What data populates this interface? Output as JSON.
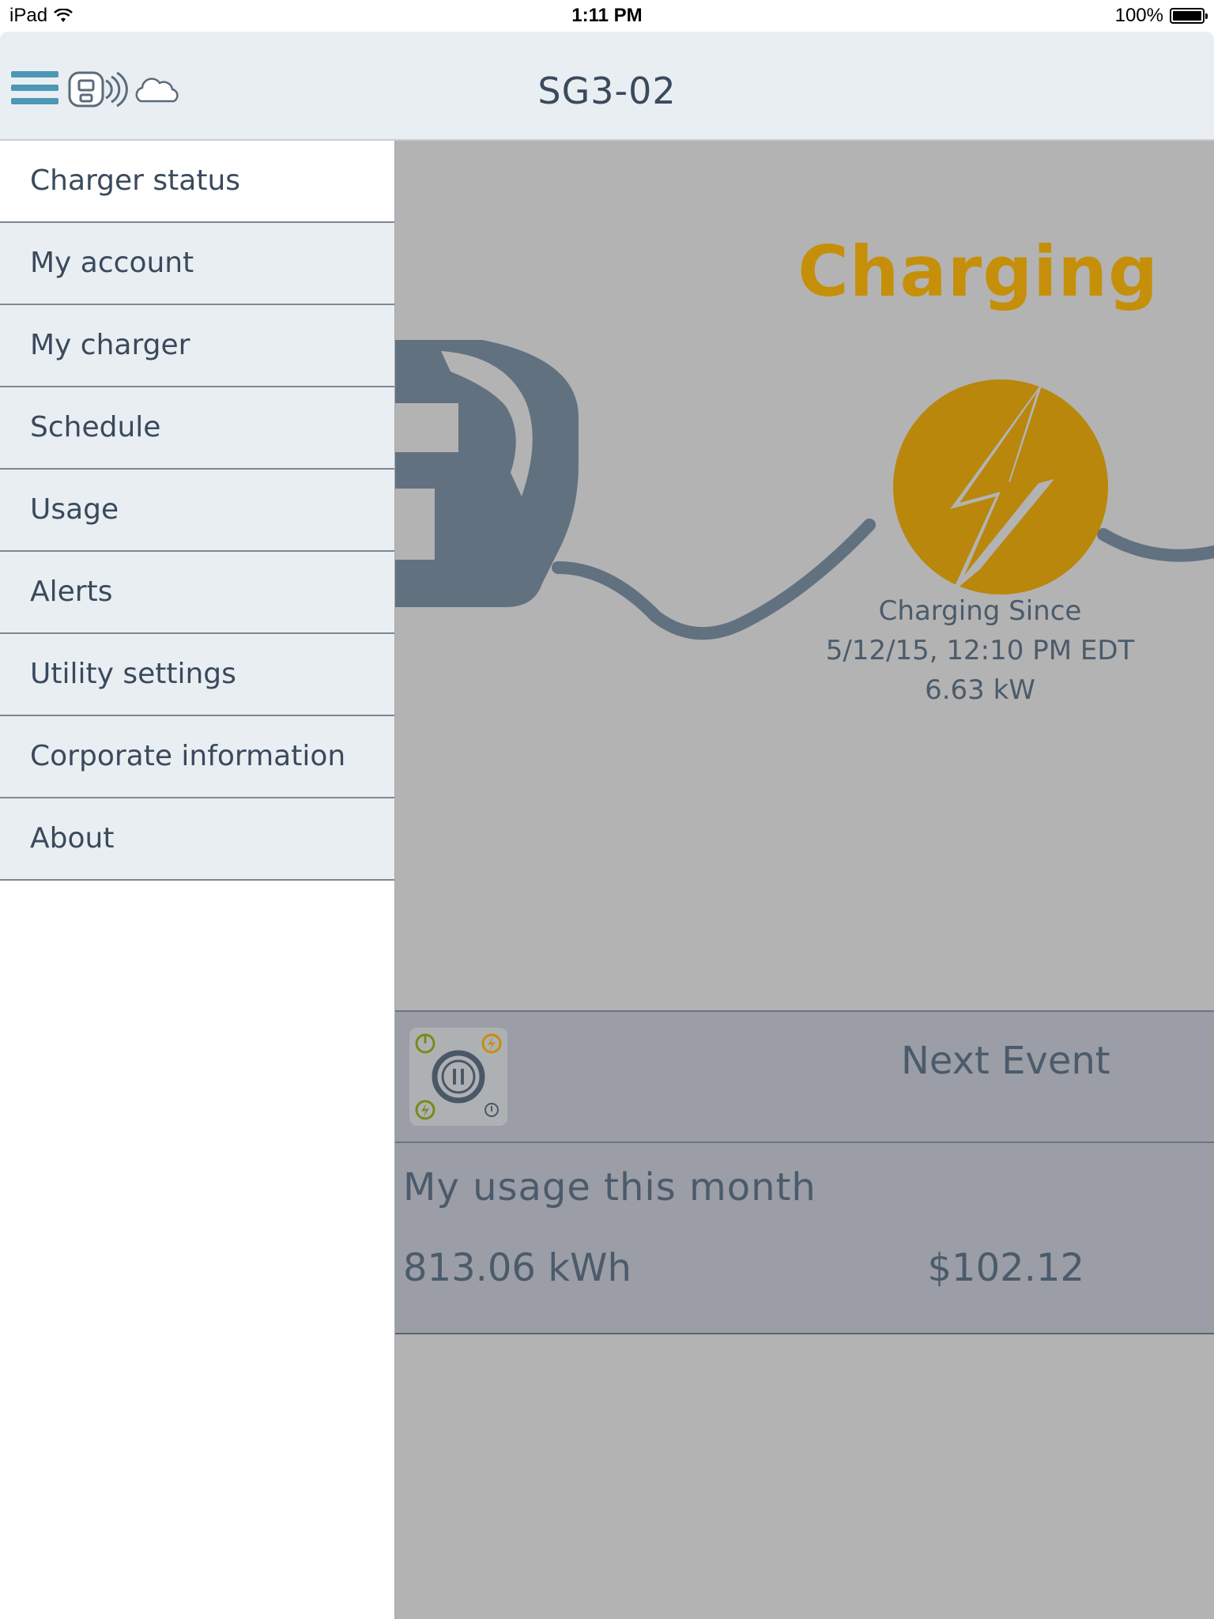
{
  "status_bar": {
    "device": "iPad",
    "time": "1:11 PM",
    "battery": "100%"
  },
  "header": {
    "title": "SG3-02",
    "icons": [
      "menu-icon",
      "charger-wifi-icon",
      "cloud-icon"
    ]
  },
  "menu": {
    "items": [
      {
        "label": "Charger status",
        "active": true
      },
      {
        "label": "My account"
      },
      {
        "label": "My charger"
      },
      {
        "label": "Schedule"
      },
      {
        "label": "Usage"
      },
      {
        "label": "Alerts"
      },
      {
        "label": "Utility settings"
      },
      {
        "label": "Corporate information"
      },
      {
        "label": "About"
      }
    ]
  },
  "status": {
    "state": "Charging",
    "since_label": "Charging Since",
    "since_value": "5/12/15, 12:10 PM EDT",
    "power": "6.63 kW"
  },
  "next_event": {
    "label": "Next Event"
  },
  "usage": {
    "title": "My usage this month",
    "energy": "813.06 kWh",
    "cost": "$102.12"
  },
  "colors": {
    "accent_orange": "#c68f0a",
    "menu_blue": "#4c97b6",
    "drawer_bg": "#e9eef3",
    "overlay_gray": "#b3b3b3"
  }
}
